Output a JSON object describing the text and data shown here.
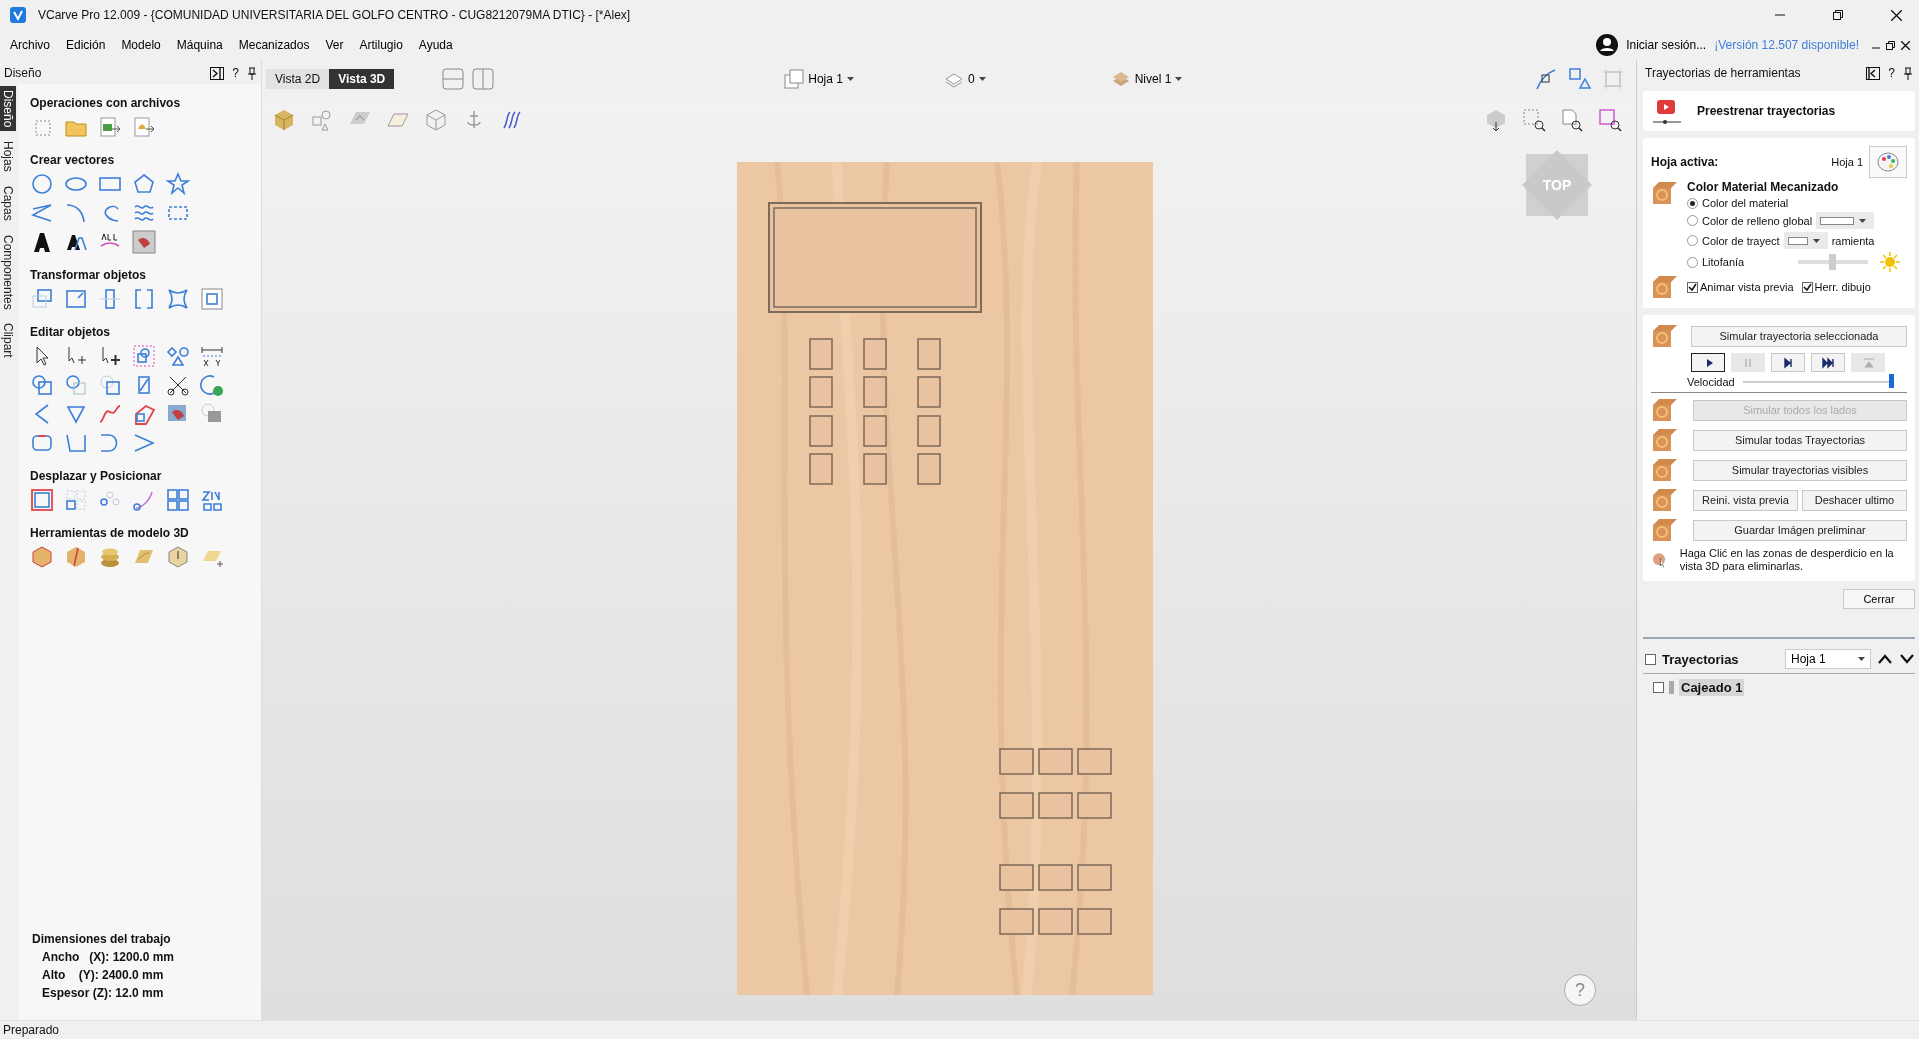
{
  "window": {
    "title": "VCarve Pro 12.009 - {COMUNIDAD UNIVERSITARIA DEL GOLFO CENTRO - CUG8212079MA DTIC} - [*Alex]"
  },
  "menu": [
    "Archivo",
    "Edición",
    "Modelo",
    "Máquina",
    "Mecanizados",
    "Ver",
    "Artilugio",
    "Ayuda"
  ],
  "account": {
    "sign_in": "Iniciar sesión...",
    "update_link": "¡Versión 12.507 disponible!"
  },
  "left_panel": {
    "title": "Diseño",
    "help": "?",
    "side_tabs": [
      {
        "label": "Diseño",
        "selected": true
      },
      {
        "label": "Hojas",
        "selected": false
      },
      {
        "label": "Capas",
        "selected": false
      },
      {
        "label": "Componentes",
        "selected": false
      },
      {
        "label": "Clipart",
        "selected": false
      }
    ],
    "sections": [
      {
        "title": "Operaciones con archivos",
        "kind": "file"
      },
      {
        "title": "Crear vectores",
        "kind": "create"
      },
      {
        "title": "Transformar objetos",
        "kind": "transform"
      },
      {
        "title": "Editar objetos",
        "kind": "edit"
      },
      {
        "title": "Desplazar y Posicionar",
        "kind": "layout"
      },
      {
        "title": "Herramientas de modelo 3D",
        "kind": "model"
      }
    ],
    "job": {
      "title": "Dimensiones del trabajo",
      "lines": [
        "Ancho   (X): 1200.0 mm",
        "Alto    (Y): 2400.0 mm",
        "Espesor (Z): 12.0 mm"
      ]
    }
  },
  "view_tabs": [
    {
      "label": "Vista 2D",
      "selected": false
    },
    {
      "label": "Vista 3D",
      "selected": true
    }
  ],
  "sheet_selector": "Hoja 1",
  "copies_selector": "0",
  "level_selector": "Nivel 1",
  "view_cube": "TOP",
  "help_button": "?",
  "right_panel": {
    "title": "Trayectorias de herramientas",
    "help": "?",
    "preview_title": "Preestrenar trayectorias",
    "active_sheet_label": "Hoja activa:",
    "active_sheet": "Hoja 1",
    "color_title": "Color Material Mecanizado",
    "color_options": [
      {
        "kind": "plain",
        "label": "Color del material",
        "selected": true
      },
      {
        "kind": "swatch",
        "label": "Color de relleno global",
        "selected": false
      },
      {
        "kind": "split",
        "label": "Color de trayect",
        "label_after": "ramienta",
        "selected": false
      },
      {
        "kind": "slider",
        "label": "Litofanía",
        "selected": false,
        "level": 0.5
      }
    ],
    "checks": [
      {
        "label": "Animar vista previa",
        "checked": true
      },
      {
        "label": "Herr. dibujo",
        "checked": true
      }
    ],
    "simulate_selected": "Simular trayectoria seleccionada",
    "playback": [
      {
        "kind": "play",
        "disabled": false
      },
      {
        "kind": "pause",
        "disabled": true
      },
      {
        "kind": "step",
        "disabled": false
      },
      {
        "kind": "end",
        "disabled": false
      },
      {
        "kind": "top",
        "disabled": true
      }
    ],
    "speed": {
      "label": "Velocidad",
      "level": 1
    },
    "actions": [
      {
        "buttons": [
          {
            "label": "Simular todos los lados",
            "disabled": true
          }
        ]
      },
      {
        "buttons": [
          {
            "label": "Simular todas Trayectorias",
            "disabled": false
          }
        ]
      },
      {
        "buttons": [
          {
            "label": "Simular trayectorias visibles",
            "disabled": false
          }
        ]
      },
      {
        "buttons": [
          {
            "label": "Reini. vista previa",
            "disabled": false
          },
          {
            "label": "Deshacer ultimo",
            "disabled": false
          }
        ]
      },
      {
        "buttons": [
          {
            "label": "Guardar Imágen preliminar",
            "disabled": false
          }
        ]
      }
    ],
    "hint": "Haga Clić en las zonas de desperdicio en la vista 3D para eliminarlas.",
    "close_button": "Cerrar",
    "toolpaths": {
      "checked": false,
      "title": "Trayectorias",
      "sheet": "Hoja 1",
      "items": [
        {
          "label": "Cajeado 1",
          "checked": false,
          "selected": true
        }
      ]
    }
  },
  "status_bar": "Preparado"
}
